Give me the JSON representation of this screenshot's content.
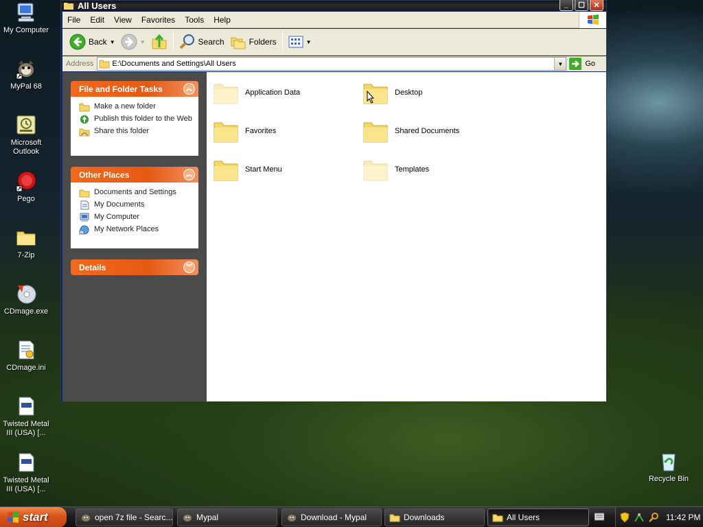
{
  "desktop": {
    "icons": [
      {
        "label": "My Computer"
      },
      {
        "label": "MyPal 68"
      },
      {
        "label": "Microsoft Outlook"
      },
      {
        "label": "Pego"
      },
      {
        "label": "7-Zip"
      },
      {
        "label": "CDmage.exe"
      },
      {
        "label": "CDmage.ini"
      },
      {
        "label": "Twisted Metal III (USA) [..."
      },
      {
        "label": "Twisted Metal III (USA) [..."
      },
      {
        "label": "Recycle Bin"
      }
    ]
  },
  "window": {
    "title": "All Users",
    "menu": [
      "File",
      "Edit",
      "View",
      "Favorites",
      "Tools",
      "Help"
    ],
    "toolbar": {
      "back": "Back",
      "search": "Search",
      "folders": "Folders"
    },
    "address": {
      "label": "Address",
      "value": "E:\\Documents and Settings\\All Users",
      "go": "Go"
    },
    "taskpane": {
      "file_tasks": {
        "title": "File and Folder Tasks",
        "items": [
          "Make a new folder",
          "Publish this folder to the Web",
          "Share this folder"
        ]
      },
      "other_places": {
        "title": "Other Places",
        "items": [
          "Documents and Settings",
          "My Documents",
          "My Computer",
          "My Network Places"
        ]
      },
      "details": {
        "title": "Details"
      }
    },
    "folders": [
      {
        "name": "Application Data",
        "faded": true
      },
      {
        "name": "Desktop",
        "faded": false
      },
      {
        "name": "Favorites",
        "faded": false
      },
      {
        "name": "Shared Documents",
        "faded": false
      },
      {
        "name": "Start Menu",
        "faded": false
      },
      {
        "name": "Templates",
        "faded": true
      }
    ]
  },
  "taskbar": {
    "start": "start",
    "buttons": [
      {
        "label": "open 7z file - Searc...",
        "active": false
      },
      {
        "label": "Mypal",
        "active": false
      },
      {
        "label": "Download - Mypal",
        "active": false
      },
      {
        "label": "Downloads",
        "active": false
      },
      {
        "label": "All Users",
        "active": true
      }
    ],
    "clock": "11:42 PM"
  },
  "colors": {
    "task_header": "#e55a12",
    "taskpane_bg": "#4b4b4b",
    "folder_yellow": "#f5d76a"
  }
}
